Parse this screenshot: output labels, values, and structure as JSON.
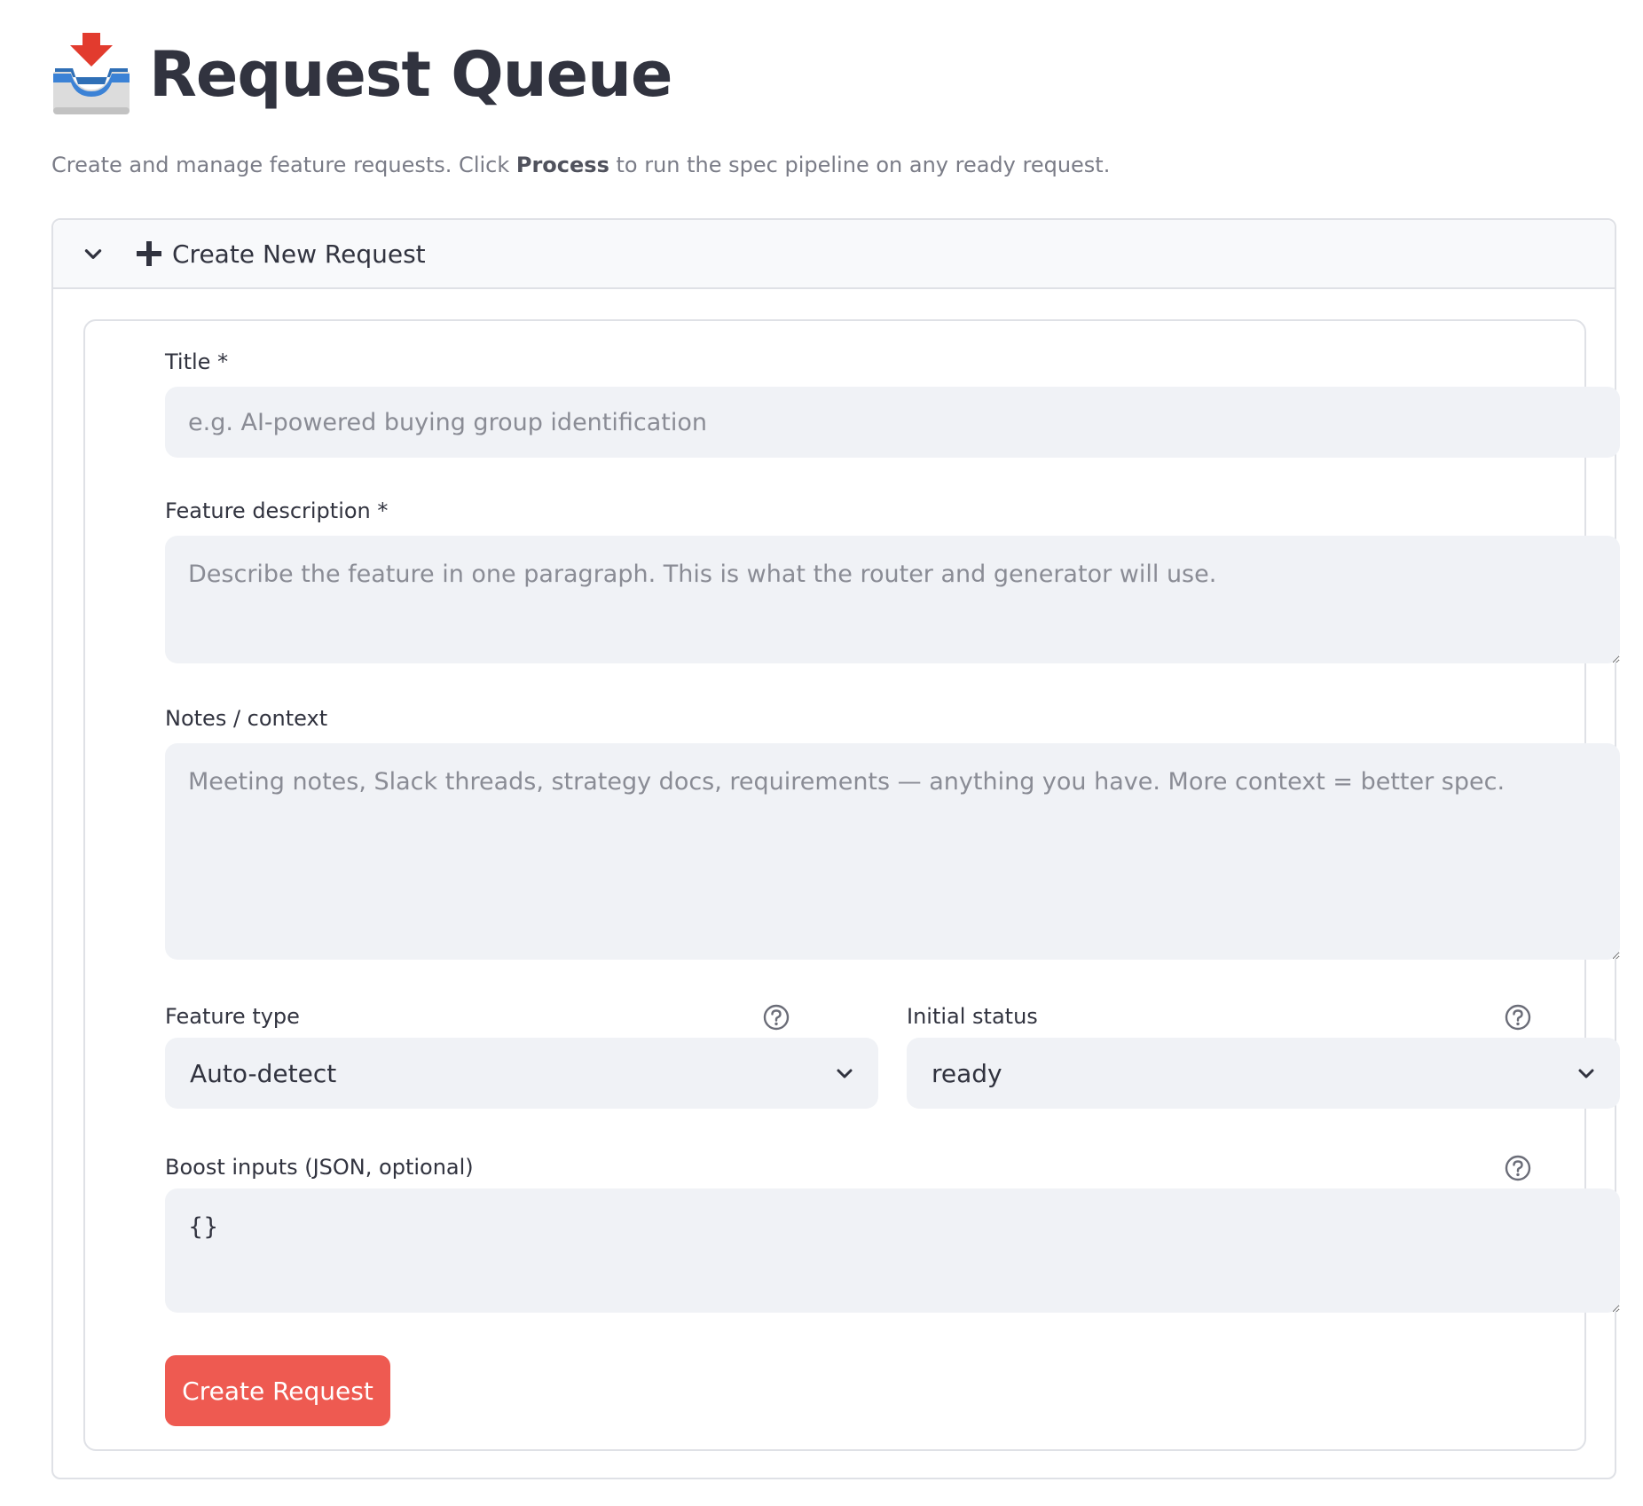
{
  "header": {
    "icon": "inbox-tray-icon",
    "title": "Request Queue"
  },
  "subtitle": {
    "before": "Create and manage feature requests. Click ",
    "bold": "Process",
    "after": " to run the spec pipeline on any ready request."
  },
  "expander": {
    "label": "Create New Request",
    "expanded": true
  },
  "form": {
    "title_label": "Title *",
    "title_placeholder": "e.g. AI-powered buying group identification",
    "description_label": "Feature description *",
    "description_placeholder": "Describe the feature in one paragraph. This is what the router and generator will use.",
    "notes_label": "Notes / context",
    "notes_placeholder": "Meeting notes, Slack threads, strategy docs, requirements — anything you have. More context = better spec.",
    "feature_type_label": "Feature type",
    "feature_type_value": "Auto-detect",
    "initial_status_label": "Initial status",
    "initial_status_value": "ready",
    "boost_label": "Boost inputs (JSON, optional)",
    "boost_value": "{}",
    "submit_label": "Create Request"
  },
  "colors": {
    "primary": "#ee5a51",
    "field_bg": "#f0f2f6",
    "text": "#31333f",
    "border": "#dfe1e6"
  }
}
